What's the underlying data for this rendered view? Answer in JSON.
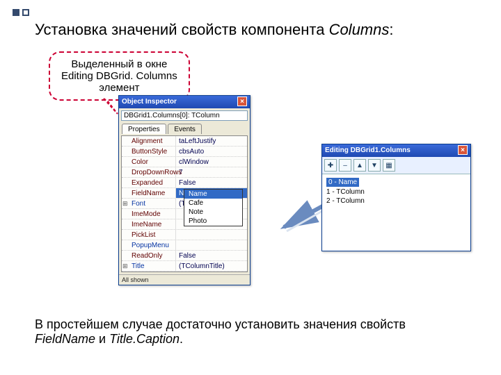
{
  "heading": {
    "pre": "Установка значений свойств компонента  ",
    "it": "Columns",
    "post": ":"
  },
  "callout": {
    "l1": "Выделенный в окне",
    "l2": "Editing DBGrid. Columns",
    "l3": "элемент"
  },
  "inspector": {
    "title": "Object Inspector",
    "selector": "DBGrid1.Columns[0]: TColumn",
    "tab_props": "Properties",
    "tab_events": "Events",
    "rows": [
      {
        "name": "Alignment",
        "val": "taLeftJustify"
      },
      {
        "name": "ButtonStyle",
        "val": "cbsAuto"
      },
      {
        "name": "Color",
        "val": "clWindow"
      },
      {
        "name": "DropDownRows",
        "val": "7"
      },
      {
        "name": "Expanded",
        "val": "False"
      },
      {
        "name": "FieldName",
        "val": "Name",
        "selected": true
      },
      {
        "name": "Font",
        "val": "(TFont)",
        "expand": true,
        "link": true
      },
      {
        "name": "ImeMode",
        "val": ""
      },
      {
        "name": "ImeName",
        "val": ""
      },
      {
        "name": "PickList",
        "val": ""
      },
      {
        "name": "PopupMenu",
        "val": "",
        "link": true
      },
      {
        "name": "ReadOnly",
        "val": "False"
      },
      {
        "name": "Title",
        "val": "(TColumnTitle)",
        "expand": true,
        "link": true
      }
    ],
    "dropdown": [
      "Name",
      "Cafe",
      "Note",
      "Photo"
    ],
    "status": "All shown"
  },
  "editor": {
    "title": "Editing DBGrid1.Columns",
    "items": [
      {
        "label": "0 - Name",
        "hl": true
      },
      {
        "label": "1 - TColumn"
      },
      {
        "label": "2 - TColumn"
      }
    ]
  },
  "footer": {
    "t1": "В простейшем случае достаточно установить значения свойств  ",
    "f1": "FieldName",
    "mid": "  и  ",
    "f2": "Title.Caption",
    "end": "."
  }
}
